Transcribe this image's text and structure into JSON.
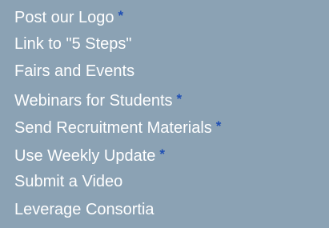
{
  "colors": {
    "background": "#8ba2b4",
    "text": "#ffffff",
    "asterisk": "#1f4fb4"
  },
  "menu": {
    "items": [
      {
        "label": "Post our Logo",
        "marker": "*"
      },
      {
        "label": "Link to \"5 Steps\"",
        "marker": ""
      },
      {
        "label": "Fairs and Events",
        "marker": ""
      },
      {
        "label": "Webinars for Students",
        "marker": "*"
      },
      {
        "label": "Send Recruitment Materials",
        "marker": "*"
      },
      {
        "label": "Use Weekly Update",
        "marker": "*"
      },
      {
        "label": "Submit a Video",
        "marker": ""
      },
      {
        "label": "Leverage Consortia",
        "marker": ""
      }
    ]
  }
}
